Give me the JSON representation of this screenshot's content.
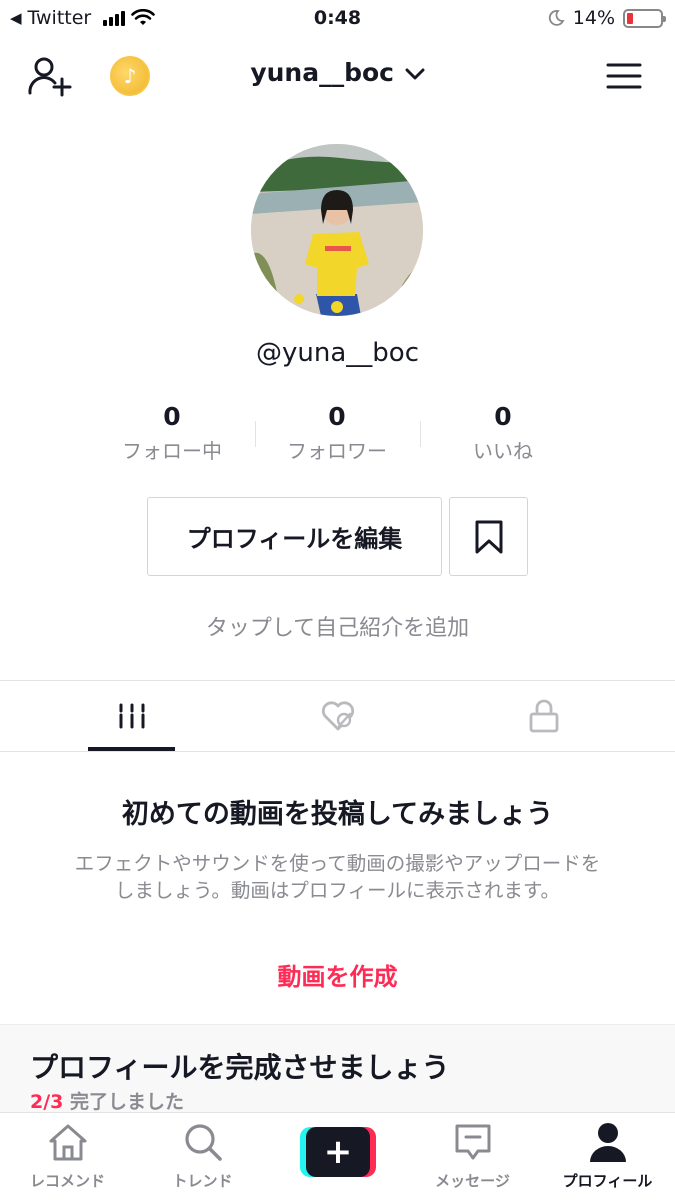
{
  "status_bar": {
    "back_app": "Twitter",
    "time": "0:48",
    "battery_percent": "14%",
    "battery_level": 0.14
  },
  "nav": {
    "username": "yuna__boc",
    "icons": [
      "add-user-icon",
      "coin-icon",
      "chevron-down-icon",
      "menu-icon"
    ]
  },
  "profile": {
    "handle": "@yuna__boc",
    "stats": [
      {
        "value": "0",
        "label": "フォロー中"
      },
      {
        "value": "0",
        "label": "フォロワー"
      },
      {
        "value": "0",
        "label": "いいね"
      }
    ],
    "edit_label": "プロフィールを編集",
    "bio_placeholder": "タップして自己紹介を追加"
  },
  "tabs": [
    {
      "icon": "grid-icon",
      "active": true
    },
    {
      "icon": "liked-hidden-icon",
      "active": false
    },
    {
      "icon": "lock-icon",
      "active": false
    }
  ],
  "empty_state": {
    "title": "初めての動画を投稿してみましょう",
    "description": "エフェクトやサウンドを使って動画の撮影やアップロードをしましょう。動画はプロフィールに表示されます。",
    "action": "動画を作成"
  },
  "completion": {
    "title": "プロフィールを完成させましょう",
    "progress": "2/3",
    "suffix": " 完了しました"
  },
  "tab_bar": [
    {
      "label": "レコメンド",
      "icon": "home-icon"
    },
    {
      "label": "トレンド",
      "icon": "search-icon"
    },
    {
      "label": "",
      "icon": "plus-icon"
    },
    {
      "label": "メッセージ",
      "icon": "message-icon"
    },
    {
      "label": "プロフィール",
      "icon": "profile-icon",
      "active": true
    }
  ],
  "colors": {
    "accent": "#fe2c55",
    "text": "#161823",
    "muted": "#8a8b91",
    "cyan": "#25f4ee",
    "coin": "#f0b429"
  }
}
